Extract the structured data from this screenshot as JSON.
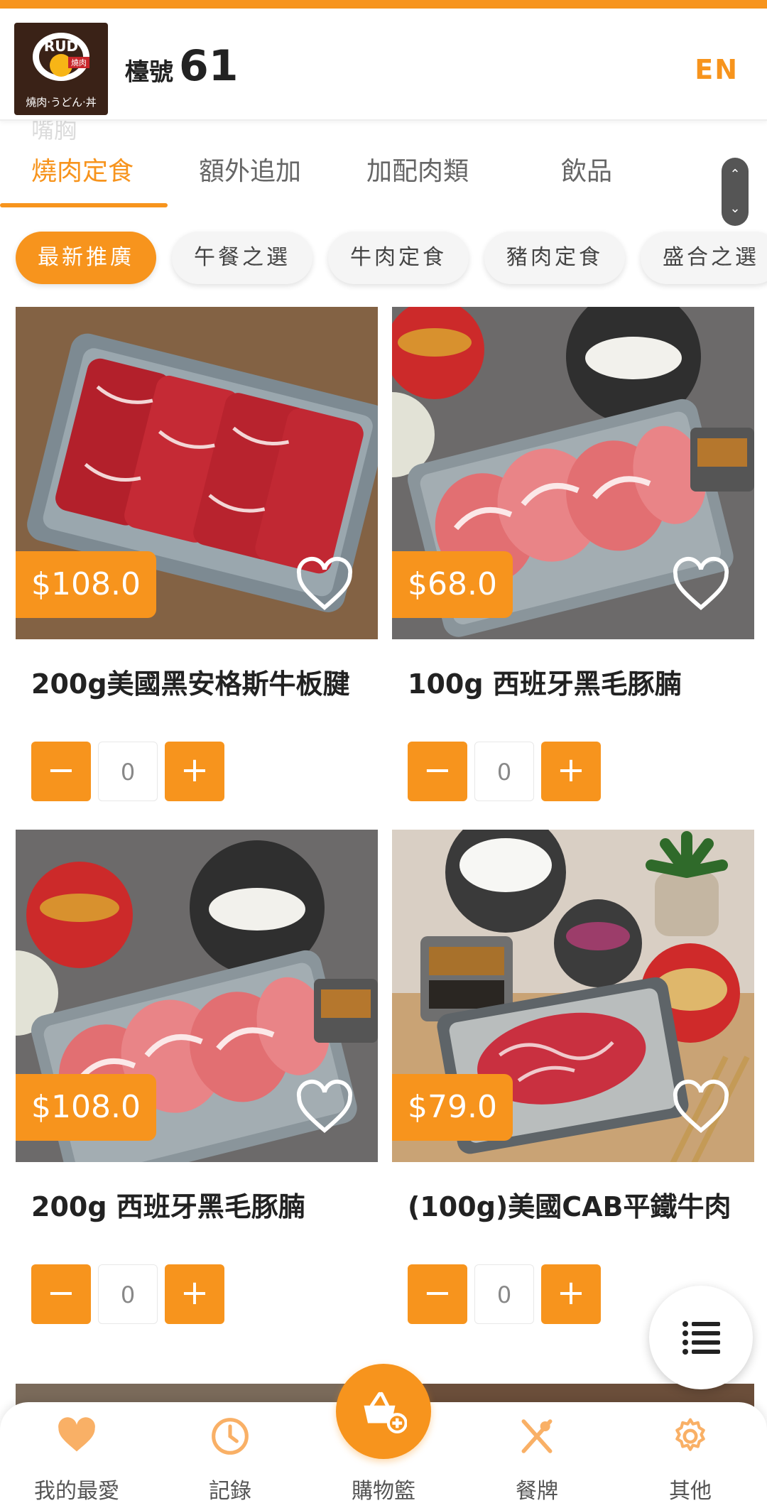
{
  "header": {
    "logo_text": "RUD",
    "logo_badge": "燒肉",
    "logo_sub": "燒肉·うどん·丼",
    "counter_label": "檯號",
    "counter_number": "61",
    "lang_button": "EN"
  },
  "ghost_text": {
    "under_header": "嘴胸"
  },
  "tabs": [
    {
      "label": "燒肉定食",
      "active": true
    },
    {
      "label": "額外追加",
      "active": false
    },
    {
      "label": "加配肉類",
      "active": false
    },
    {
      "label": "飲品",
      "active": false
    }
  ],
  "chips": [
    {
      "label": "最新推廣",
      "active": true
    },
    {
      "label": "午餐之選",
      "active": false
    },
    {
      "label": "牛肉定食",
      "active": false
    },
    {
      "label": "豬肉定食",
      "active": false
    },
    {
      "label": "盛合之選",
      "active": false
    }
  ],
  "products": [
    {
      "price": "$108.0",
      "name": "200g美國黑安格斯牛板腱",
      "qty": "0"
    },
    {
      "price": "$68.0",
      "name": "100g 西班牙黑毛豚腩",
      "qty": "0"
    },
    {
      "price": "$108.0",
      "name": "200g 西班牙黑毛豚腩",
      "qty": "0"
    },
    {
      "price": "$79.0",
      "name": "(100g)美國CAB平鐵牛肉",
      "qty": "0"
    }
  ],
  "bottom_nav": {
    "favorites": "我的最愛",
    "records": "記錄",
    "cart": "購物籃",
    "menu": "餐牌",
    "others": "其他"
  },
  "colors": {
    "accent": "#f7941d"
  }
}
